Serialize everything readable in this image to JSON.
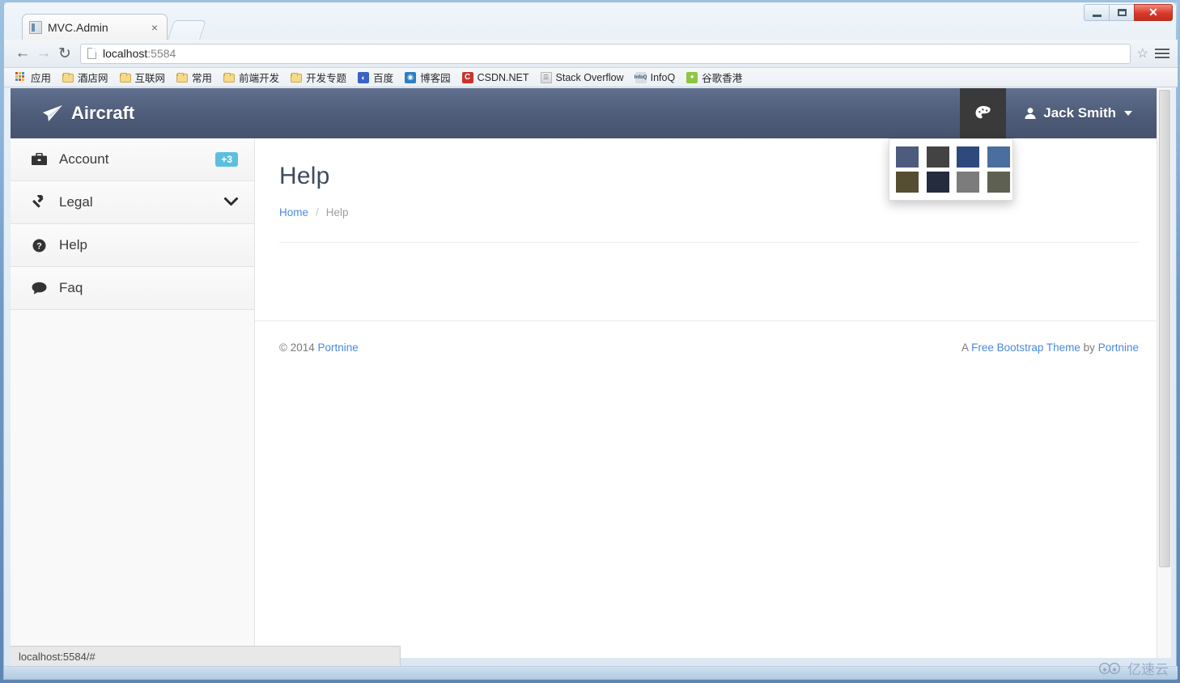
{
  "browser": {
    "tab": {
      "title": "MVC.Admin",
      "close_label": "×",
      "favicon_icon": "page-favicon"
    },
    "nav": {
      "back": "←",
      "forward": "→",
      "reload": "↻"
    },
    "address": {
      "host": "localhost",
      "port": ":5584",
      "star": "☆"
    },
    "bookmarks": [
      {
        "label": "应用",
        "icon": "apps-grid-icon"
      },
      {
        "label": "酒店网",
        "icon": "folder-icon"
      },
      {
        "label": "互联网",
        "icon": "folder-icon"
      },
      {
        "label": "常用",
        "icon": "folder-icon"
      },
      {
        "label": "前端开发",
        "icon": "folder-icon"
      },
      {
        "label": "开发专题",
        "icon": "folder-icon"
      },
      {
        "label": "百度",
        "icon": "baidu-icon"
      },
      {
        "label": "博客园",
        "icon": "cnblogs-icon"
      },
      {
        "label": "CSDN.NET",
        "icon": "csdn-icon"
      },
      {
        "label": "Stack Overflow",
        "icon": "stackoverflow-icon"
      },
      {
        "label": "InfoQ",
        "icon": "infoq-icon"
      },
      {
        "label": "谷歌香港",
        "icon": "google-icon"
      }
    ],
    "window_controls": {
      "minimize": "minimize-icon",
      "maximize": "maximize-icon",
      "close": "✕"
    },
    "status_text": "localhost:5584/#"
  },
  "app": {
    "brand": {
      "label": "Aircraft",
      "icon": "paper-plane-icon"
    },
    "navbar": {
      "palette_icon": "palette-icon",
      "user": {
        "name": "Jack Smith",
        "avatar_icon": "user-icon",
        "caret_icon": "caret-down-icon"
      }
    },
    "palette_menu": {
      "swatches": [
        {
          "name": "slate-blue",
          "color": "#4d5b7c"
        },
        {
          "name": "dark-gray",
          "color": "#434343"
        },
        {
          "name": "navy-blue",
          "color": "#2e4a7d"
        },
        {
          "name": "steel-blue",
          "color": "#4a6e9e"
        },
        {
          "name": "olive-brown",
          "color": "#564e33"
        },
        {
          "name": "midnight",
          "color": "#242c3d"
        },
        {
          "name": "gray",
          "color": "#7c7c7c"
        },
        {
          "name": "olive-gray",
          "color": "#5e6052"
        }
      ]
    },
    "sidebar": {
      "items": [
        {
          "label": "Account",
          "icon": "briefcase-icon",
          "badge": "+3",
          "chevron": ""
        },
        {
          "label": "Legal",
          "icon": "gavel-icon",
          "badge": "",
          "chevron": "❯"
        },
        {
          "label": "Help",
          "icon": "question-circle-icon",
          "badge": "",
          "chevron": ""
        },
        {
          "label": "Faq",
          "icon": "comment-icon",
          "badge": "",
          "chevron": ""
        }
      ]
    },
    "content": {
      "title": "Help",
      "breadcrumb": {
        "home": "Home",
        "separator": "/",
        "current": "Help"
      }
    },
    "footer": {
      "copyright": "© 2014",
      "copyright_link": "Portnine",
      "right_prefix": "A",
      "right_link": "Free Bootstrap Theme",
      "right_middle": "by",
      "right_link2": "Portnine"
    }
  },
  "watermark": {
    "text": "亿速云",
    "icon": "cloud-logo-icon"
  }
}
